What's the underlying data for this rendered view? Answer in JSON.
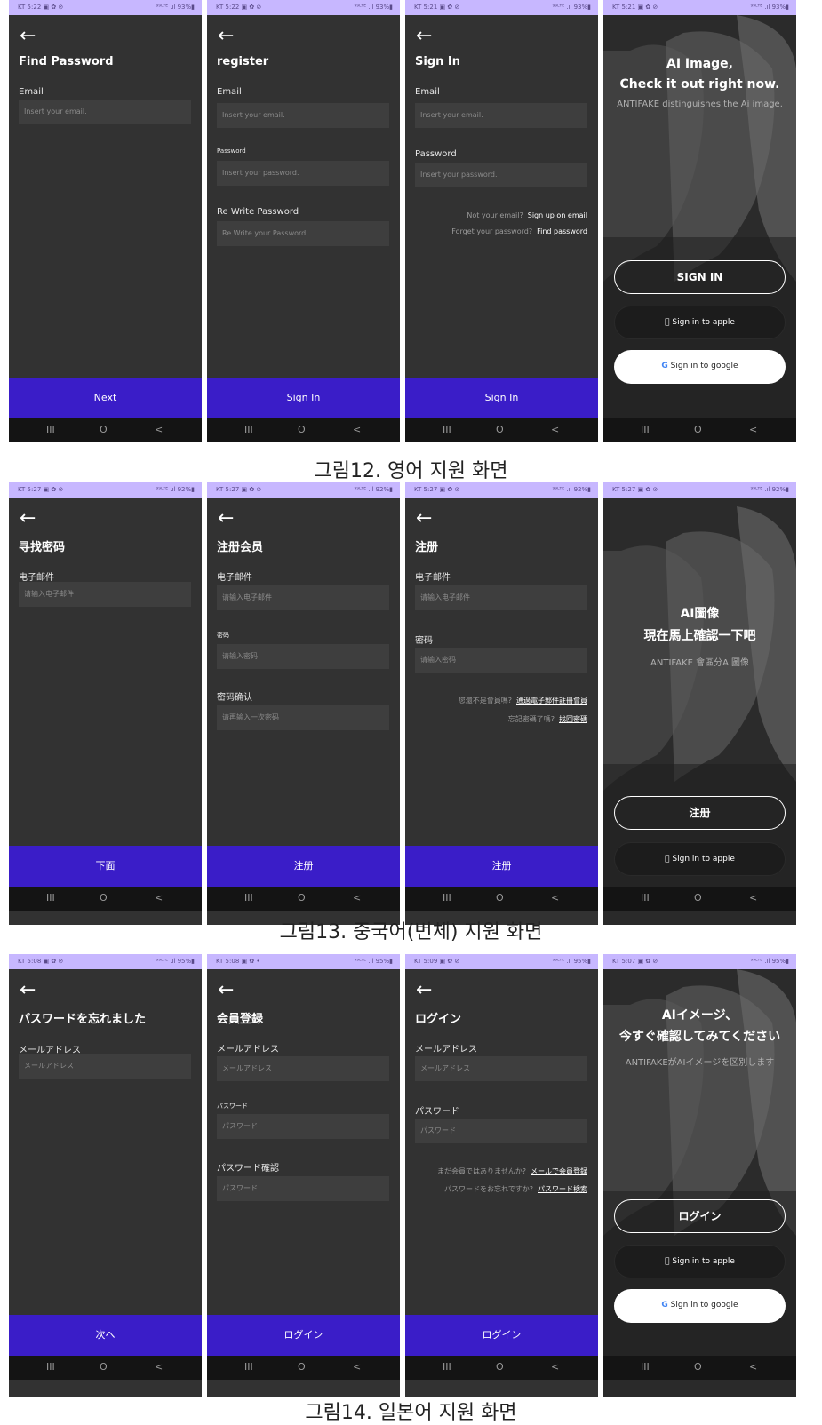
{
  "common": {
    "back_arrow": "←",
    "nav": [
      "III",
      "O",
      "<"
    ]
  },
  "row1": {
    "caption": "그림12. 영어 지원 화면",
    "find": {
      "status_left": "KT 5:22 ▣ ✿ ⊘",
      "status_right": "⁹⁹ᴸᵀᴱ .ıl 93%▮",
      "title": "Find Password",
      "email_label": "Email",
      "email_placeholder": "Insert your email.",
      "button": "Next"
    },
    "register": {
      "status_left": "KT 5:22 ▣ ✿ ⊘",
      "status_right": "⁹⁹ᴸᵀᴱ .ıl 93%▮",
      "title": "register",
      "email_label": "Email",
      "email_placeholder": "Insert your email.",
      "password_label": "Password",
      "password_placeholder": "Insert your password.",
      "repw_label": "Re Write Password",
      "repw_placeholder": "Re Write your Password.",
      "button": "Sign In"
    },
    "signin": {
      "status_left": "KT 5:21 ▣ ✿ ⊘",
      "status_right": "⁹⁹ᴸᵀᴱ .ıl 93%▮",
      "title": "Sign In",
      "email_label": "Email",
      "email_placeholder": "Insert your email.",
      "password_label": "Password",
      "password_placeholder": "Insert your password.",
      "q1": "Not your email?",
      "link1": "Sign up on email",
      "q2": "Forget your password?",
      "link2": "Find password",
      "button": "Sign In"
    },
    "landing": {
      "status_left": "KT 5:21 ▣ ✿ ⊘",
      "status_right": "⁹⁹ᴸᵀᴱ .ıl 93%▮",
      "title_line1": "AI Image,",
      "title_line2": "Check it out right now.",
      "subtitle": "ANTIFAKE distinguishes the Ai image.",
      "signin_button": "SIGN IN",
      "apple_button": "Sign in to apple",
      "google_button": "Sign in to google"
    }
  },
  "row2": {
    "caption": "그림13. 중국어(번체) 지원 화면",
    "find": {
      "status_left": "KT 5:27 ▣ ✿ ⊘",
      "status_right": "⁹⁹ᴸᵀᴱ .ıl 92%▮",
      "title": "寻找密码",
      "email_label": "电子邮件",
      "email_placeholder": "请输入电子邮件",
      "button": "下面"
    },
    "register": {
      "status_left": "KT 5:27 ▣ ✿ ⊘",
      "status_right": "⁹⁹ᴸᵀᴱ .ıl 92%▮",
      "title": "注册会员",
      "email_label": "电子邮件",
      "email_placeholder": "请输入电子邮件",
      "password_label": "密码",
      "password_placeholder": "请输入密码",
      "repw_label": "密码确认",
      "repw_placeholder": "请再输入一次密码",
      "button": "注册"
    },
    "signin": {
      "status_left": "KT 5:27 ▣ ✿ ⊘",
      "status_right": "⁹⁹ᴸᵀᴱ .ıl 92%▮",
      "title": "注册",
      "email_label": "电子邮件",
      "email_placeholder": "请输入电子邮件",
      "password_label": "密码",
      "password_placeholder": "请输入密码",
      "q1": "您還不是會員嗎?",
      "link1": "通過電子郵件註冊會員",
      "q2": "忘記密碼了嗎?",
      "link2": "找回密碼",
      "button": "注册"
    },
    "landing": {
      "status_left": "KT 5:27 ▣ ✿ ⊘",
      "status_right": "⁹⁹ᴸᵀᴱ .ıl 92%▮",
      "title_line1": "AI圖像",
      "title_line2": "現在馬上確認一下吧",
      "subtitle": "ANTIFAKE 會區分AI圖像",
      "signin_button": "注册",
      "apple_button": "Sign in to apple"
    }
  },
  "row3": {
    "caption": "그림14. 일본어 지원 화면",
    "find": {
      "status_left": "KT 5:08 ▣ ✿ ⊘",
      "status_right": "⁹⁹ᴸᵀᴱ .ıl 95%▮",
      "title": "パスワードを忘れました",
      "email_label": "メールアドレス",
      "email_placeholder": "メールアドレス",
      "button": "次へ"
    },
    "register": {
      "status_left": "KT 5:08 ▣ ✿ •",
      "status_right": "⁹⁹ᴸᵀᴱ .ıl 95%▮",
      "title": "会員登録",
      "email_label": "メールアドレス",
      "email_placeholder": "メールアドレス",
      "password_label": "パスワード",
      "password_placeholder": "パスワード",
      "repw_label": "パスワード確認",
      "repw_placeholder": "パスワード",
      "button": "ログイン"
    },
    "signin": {
      "status_left": "KT 5:09 ▣ ✿ ⊘",
      "status_right": "⁹⁹ᴸᵀᴱ .ıl 95%▮",
      "title": "ログイン",
      "email_label": "メールアドレス",
      "email_placeholder": "メールアドレス",
      "password_label": "パスワード",
      "password_placeholder": "パスワード",
      "q1": "まだ会員ではありませんか?",
      "link1": "メールで会員登録",
      "q2": "パスワードをお忘れですか?",
      "link2": "パスワード検索",
      "button": "ログイン"
    },
    "landing": {
      "status_left": "KT 5:07 ▣ ✿ ⊘",
      "status_right": "⁹⁹ᴸᵀᴱ .ıl 95%▮",
      "title_line1": "AIイメージ、",
      "title_line2": "今すぐ確認してみてください",
      "subtitle": "ANTIFAKEがAIイメージを区別します",
      "signin_button": "ログイン",
      "apple_button": "Sign in to apple",
      "google_button": "Sign in to google"
    }
  }
}
